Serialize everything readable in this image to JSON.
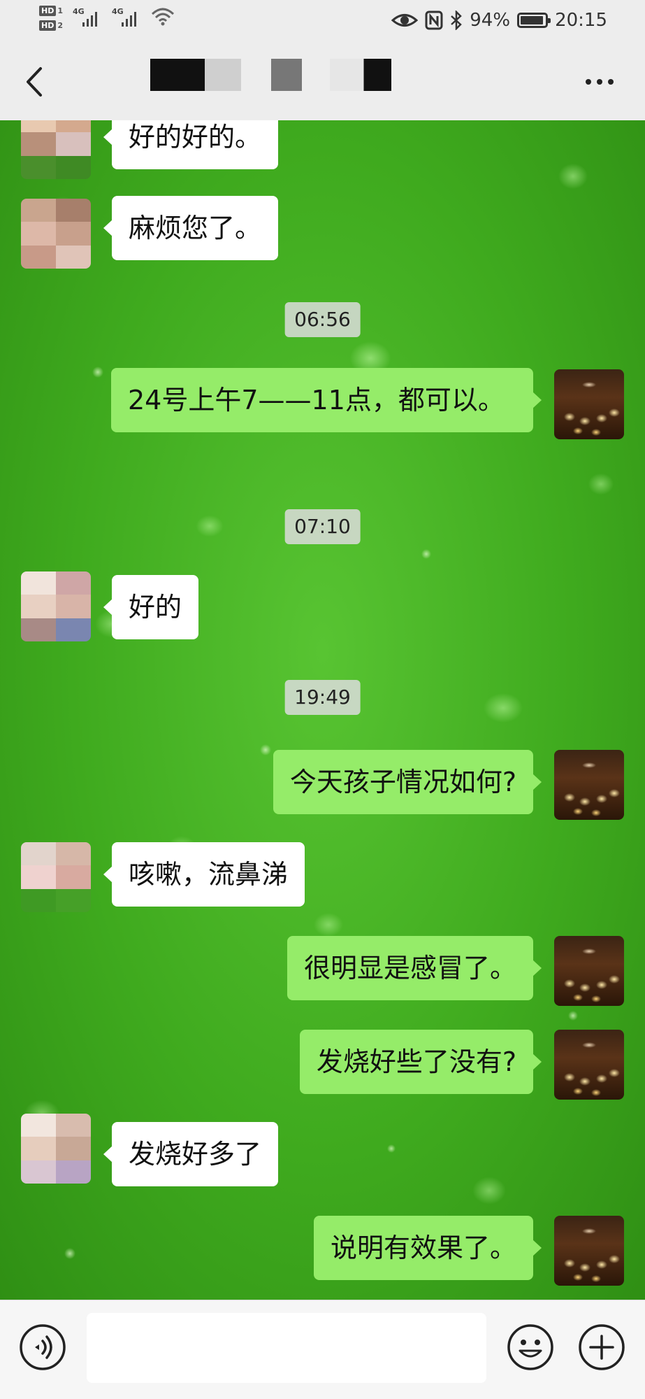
{
  "status_bar": {
    "sim1": "HD 1",
    "sim2": "HD 2",
    "network1": "4G",
    "network2": "4G",
    "battery_percent": "94%",
    "battery_level": 0.94,
    "time": "20:15",
    "icons": [
      "hd-sim-icon",
      "signal-icon",
      "wifi-icon",
      "eye-icon",
      "nfc-icon",
      "bluetooth-icon",
      "battery-icon"
    ]
  },
  "header": {
    "title": "",
    "back_icon": "chevron-left-icon",
    "more_icon": "more-dots-icon"
  },
  "messages": [
    {
      "type": "text",
      "side": "in",
      "text": "好的好的。"
    },
    {
      "type": "text",
      "side": "in",
      "text": "麻烦您了。"
    },
    {
      "type": "time",
      "text": "06:56"
    },
    {
      "type": "text",
      "side": "out",
      "text": "24号上午7——11点，都可以。"
    },
    {
      "type": "time",
      "text": "07:10"
    },
    {
      "type": "text",
      "side": "in",
      "text": "好的"
    },
    {
      "type": "time",
      "text": "19:49"
    },
    {
      "type": "text",
      "side": "out",
      "text": "今天孩子情况如何?"
    },
    {
      "type": "text",
      "side": "in",
      "text": "咳嗽，流鼻涕"
    },
    {
      "type": "text",
      "side": "out",
      "text": "很明显是感冒了。"
    },
    {
      "type": "text",
      "side": "out",
      "text": "发烧好些了没有?"
    },
    {
      "type": "text",
      "side": "in",
      "text": "发烧好多了"
    },
    {
      "type": "text",
      "side": "out",
      "text": "说明有效果了。"
    }
  ],
  "input_bar": {
    "placeholder": "",
    "value": "",
    "voice_icon": "voice-icon",
    "emoji_icon": "emoji-icon",
    "plus_icon": "plus-icon"
  },
  "colors": {
    "bubble_out": "#95ec69",
    "bubble_in": "#ffffff",
    "chat_background": "#46b020",
    "bar_background": "#ededed"
  }
}
